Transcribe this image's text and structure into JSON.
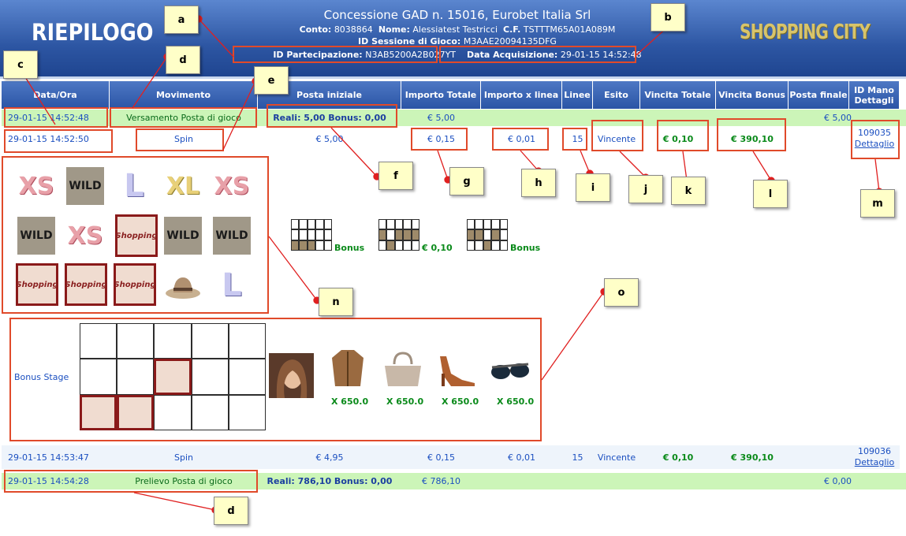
{
  "header": {
    "title": "RIEPILOGO",
    "concession": "Concessione GAD n. 15016, Eurobet Italia Srl",
    "conto_label": "Conto:",
    "conto": "8038864",
    "nome_label": "Nome:",
    "nome": "Alessiatest Testricci",
    "cf_label": "C.F.",
    "cf": "TSTTTM65A01A089M",
    "sessione_label": "ID Sessione di Gioco:",
    "sessione": "M3AAE20094135DFG",
    "partecipazione_label": "ID Partecipazione:",
    "partecipazione": "N3AB5200A2B027YT",
    "acquisizione_label": "Data Acquisizione:",
    "acquisizione": "29-01-15 14:52:48",
    "brand": "SHOPPING CITY"
  },
  "columns": [
    "Data/Ora",
    "Movimento",
    "Posta iniziale",
    "Importo Totale",
    "Importo x linea",
    "Linee",
    "Esito",
    "Vincita Totale",
    "Vincita Bonus",
    "Posta finale",
    "ID Mano Dettagli"
  ],
  "rows": [
    {
      "date": "29-01-15 14:52:48",
      "movimento": "Versamento Posta di gioco",
      "posta": "Reali: 5,00 Bonus: 0,00",
      "importo": "€ 5,00",
      "xlinea": "",
      "linee": "",
      "esito": "",
      "vincita": "",
      "bonus": "",
      "finale": "€ 5,00",
      "id": "",
      "link": ""
    },
    {
      "date": "29-01-15 14:52:50",
      "movimento": "Spin",
      "posta": "€ 5,00",
      "importo": "€ 0,15",
      "xlinea": "€ 0,01",
      "linee": "15",
      "esito": "Vincente",
      "vincita": "€ 0,10",
      "bonus": "€ 390,10",
      "finale": "",
      "id": "109035",
      "link": "Dettaglio"
    },
    {
      "date": "29-01-15 14:53:47",
      "movimento": "Spin",
      "posta": "€ 4,95",
      "importo": "€ 0,15",
      "xlinea": "€ 0,01",
      "linee": "15",
      "esito": "Vincente",
      "vincita": "€ 0,10",
      "bonus": "€ 390,10",
      "finale": "",
      "id": "109036",
      "link": "Dettaglio"
    },
    {
      "date": "29-01-15 14:54:28",
      "movimento": "Prelievo Posta di gioco",
      "posta": "Reali: 786,10 Bonus: 0,00",
      "importo": "€ 786,10",
      "xlinea": "",
      "linee": "",
      "esito": "",
      "vincita": "",
      "bonus": "",
      "finale": "€ 0,00",
      "id": "",
      "link": ""
    }
  ],
  "reels": [
    [
      "XS",
      "WILD",
      "L",
      "XL",
      "XS"
    ],
    [
      "WILD",
      "XS",
      "Shopping",
      "WILD",
      "WILD"
    ],
    [
      "Shopping",
      "Shopping",
      "Shopping",
      "hat",
      "L"
    ]
  ],
  "paylines": [
    {
      "label": "Bonus"
    },
    {
      "label": "€ 0,10"
    },
    {
      "label": "Bonus"
    }
  ],
  "bonus_stage": {
    "label": "Bonus Stage",
    "prizes": [
      "X 650.0",
      "X 650.0",
      "X 650.0",
      "X 650.0"
    ],
    "prize_icons": [
      "jacket-icon",
      "handbag-icon",
      "shoes-icon",
      "sunglasses-icon"
    ]
  },
  "annotations": [
    "a",
    "b",
    "c",
    "d",
    "e",
    "f",
    "g",
    "h",
    "i",
    "j",
    "k",
    "l",
    "m",
    "n",
    "o",
    "d"
  ],
  "colors": {
    "header": "#2d56a3",
    "green_row": "#ccf5b8",
    "annotation_red": "#e04a2a",
    "note": "#ffffc8"
  }
}
